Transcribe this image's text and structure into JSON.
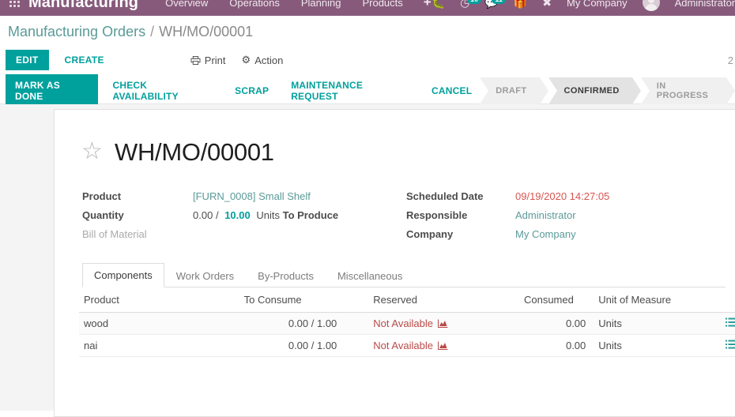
{
  "navbar": {
    "apps_icon": "apps-grid-icon",
    "brand": "Manufacturing",
    "menus": [
      "Overview",
      "Operations",
      "Planning",
      "Products"
    ],
    "plus_label": "+",
    "systray": [
      {
        "icon": "bug-icon",
        "badge": ""
      },
      {
        "icon": "clock-activity-icon",
        "badge": "10"
      },
      {
        "icon": "messages-icon",
        "badge": "11"
      },
      {
        "icon": "gift-icon",
        "badge": ""
      },
      {
        "icon": "wrench-icon",
        "badge": ""
      }
    ],
    "company": "My Company",
    "user": "Administrator",
    "brand_color": "#875A7B",
    "accent_color": "#00A09D"
  },
  "breadcrumb": {
    "parent": "Manufacturing Orders",
    "separator": "/",
    "current": "WH/MO/00001"
  },
  "controlpanel": {
    "edit_label": "EDIT",
    "create_label": "CREATE",
    "print_label": "Print",
    "print_icon": "printer-icon",
    "action_label": "Action",
    "action_icon": "gear-icon",
    "pager": "2"
  },
  "statusbuttons": {
    "primary": "MARK AS DONE",
    "others": [
      "CHECK AVAILABILITY",
      "SCRAP",
      "MAINTENANCE REQUEST",
      "CANCEL"
    ]
  },
  "statusbar": {
    "stages": [
      {
        "label": "DRAFT",
        "active": false
      },
      {
        "label": "CONFIRMED",
        "active": true
      },
      {
        "label": "IN PROGRESS",
        "active": false
      }
    ]
  },
  "record": {
    "favorite_icon": "star-outline-icon",
    "title": "WH/MO/00001",
    "left_fields": [
      {
        "label": "Product",
        "value": "[FURN_0008] Small Shelf",
        "style": "link"
      },
      {
        "label": "Quantity",
        "value": "0.00 / 10.00 Units To Produce",
        "style": "quantity"
      },
      {
        "label": "Bill of Material",
        "value": "",
        "style": "muted"
      }
    ],
    "quantity": {
      "done": "0.00",
      "separator": "/",
      "target": "10.00",
      "uom": "Units",
      "suffix": "To Produce"
    },
    "right_fields": [
      {
        "label": "Scheduled Date",
        "value": "09/19/2020 14:27:05",
        "style": "red"
      },
      {
        "label": "Responsible",
        "value": "Administrator",
        "style": "link"
      },
      {
        "label": "Company",
        "value": "My Company",
        "style": "link"
      }
    ]
  },
  "notebook": {
    "tabs": [
      {
        "label": "Components",
        "active": true
      },
      {
        "label": "Work Orders",
        "active": false
      },
      {
        "label": "By-Products",
        "active": false
      },
      {
        "label": "Miscellaneous",
        "active": false
      }
    ]
  },
  "components_table": {
    "columns": [
      "Product",
      "To Consume",
      "Reserved",
      "Consumed",
      "Unit of Measure"
    ],
    "rows": [
      {
        "product": "wood",
        "to_consume": "0.00 / 1.00",
        "reserved": "Not Available",
        "reserved_icon": "forecast-chart-icon",
        "consumed": "0.00",
        "uom": "Units",
        "action_icon": "detailed-operations-icon"
      },
      {
        "product": "nai",
        "to_consume": "0.00 / 1.00",
        "reserved": "Not Available",
        "reserved_icon": "forecast-chart-icon",
        "consumed": "0.00",
        "uom": "Units",
        "action_icon": "detailed-operations-icon"
      }
    ]
  },
  "colors": {
    "brand_purple": "#875A7B",
    "accent_teal": "#00A09D",
    "link_teal": "#5a9a98",
    "danger_red": "#d9534f",
    "warn_red": "#b94a48"
  }
}
